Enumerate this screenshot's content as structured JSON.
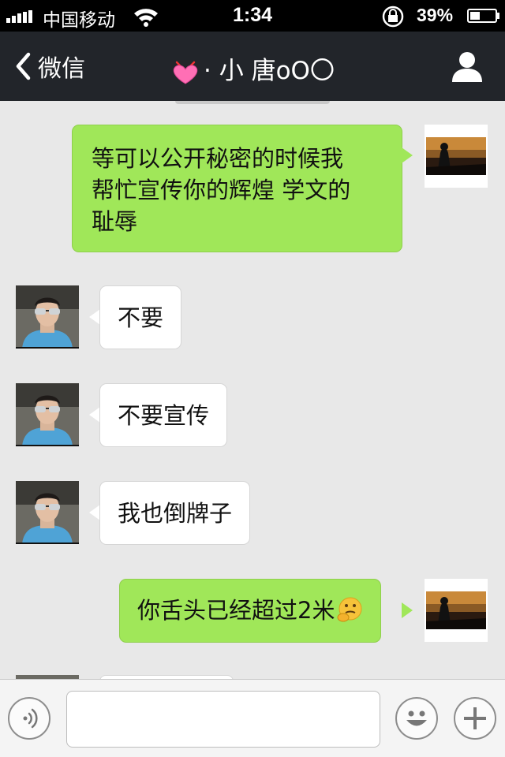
{
  "status_bar": {
    "carrier": "中国移动",
    "time": "1:34",
    "battery": "39%",
    "battery_level": 0.39
  },
  "nav": {
    "back_label": "微信",
    "title": "· 小 唐oO〇",
    "title_icon": "pink-heart-emoji"
  },
  "messages": [
    {
      "direction": "out",
      "text_lines": [
        "等可以公开秘密的时候我",
        "帮忙宣传你的辉煌 学文的",
        "耻辱"
      ]
    },
    {
      "direction": "in",
      "text": "不要"
    },
    {
      "direction": "in",
      "text": "不要宣传"
    },
    {
      "direction": "in",
      "text": "我也倒牌子"
    },
    {
      "direction": "out",
      "text": "你舌头已经超过2米",
      "emoji": "thinking-face-emoji"
    }
  ],
  "input_bar": {
    "voice_icon": "voice-icon",
    "emoji_icon": "smiley-icon",
    "plus_icon": "plus-icon"
  },
  "colors": {
    "nav_bg": "#22252a",
    "chat_bg": "#e8e8e8",
    "outgoing_bubble": "#a0e759",
    "incoming_bubble": "#ffffff"
  }
}
